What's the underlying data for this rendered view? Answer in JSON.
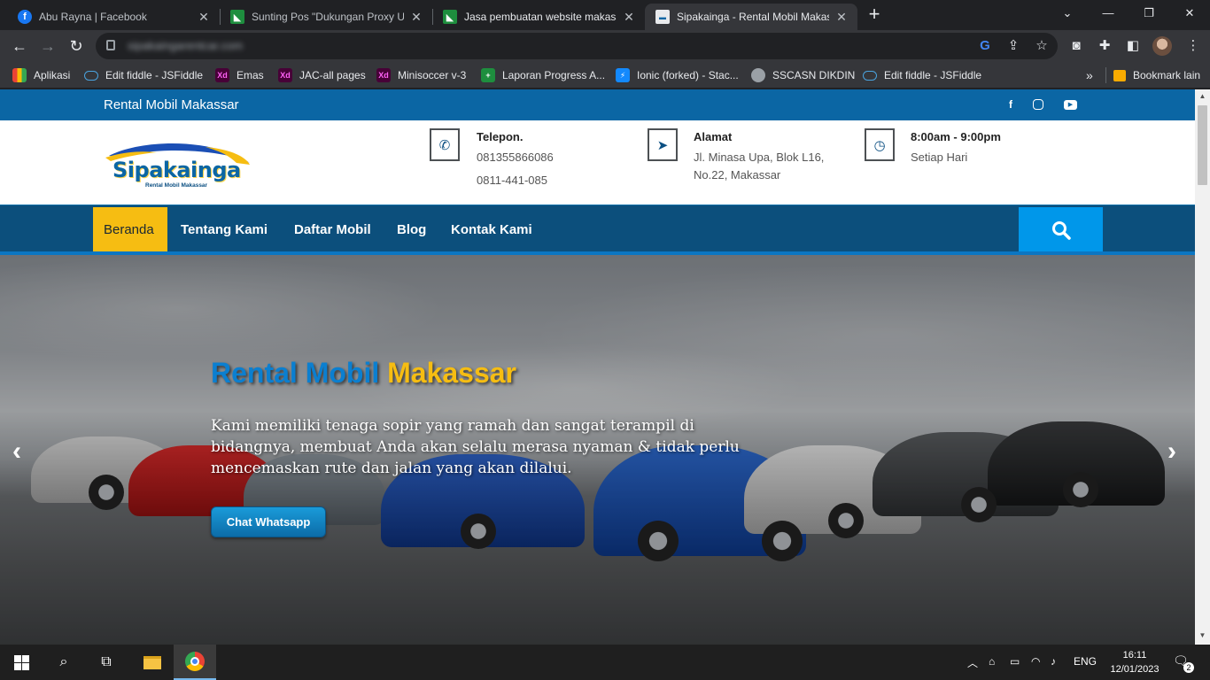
{
  "browser": {
    "tabs": [
      {
        "title": "Abu Rayna | Facebook",
        "icon": "facebook-icon"
      },
      {
        "title": "Sunting Pos \"Dukungan Proxy Ur",
        "icon": "sheet-icon"
      },
      {
        "title": "Jasa pembuatan website makassa",
        "icon": "sheet-icon"
      },
      {
        "title": "Sipakainga - Rental Mobil Makass",
        "icon": "site-icon"
      }
    ],
    "url": "sipakaingarentcar.com",
    "bookmarks": [
      {
        "label": "Aplikasi",
        "icon": "apps-grid-icon"
      },
      {
        "label": "Edit fiddle - JSFiddle",
        "icon": "cloud-icon"
      },
      {
        "label": "Emas",
        "icon": "xd-icon",
        "badge": "Xd"
      },
      {
        "label": "JAC-all pages",
        "icon": "xd-icon",
        "badge": "Xd"
      },
      {
        "label": "Minisoccer v-3",
        "icon": "xd-icon",
        "badge": "Xd"
      },
      {
        "label": "Laporan Progress A...",
        "icon": "sheet-plus-icon"
      },
      {
        "label": "Ionic (forked) - Stac...",
        "icon": "stackblitz-icon"
      },
      {
        "label": "SSCASN DIKDIN",
        "icon": "globe-icon"
      },
      {
        "label": "Edit fiddle - JSFiddle",
        "icon": "cloud-icon"
      }
    ],
    "other_bookmarks": "Bookmark lain"
  },
  "site": {
    "topbar_title": "Rental Mobil Makassar",
    "logo_text": "Sipakainga",
    "logo_sub": "Rental Mobil Makassar",
    "contact": {
      "phone_title": "Telepon.",
      "phone_1": "081355866086",
      "phone_2": "0811-441-085",
      "address_title": "Alamat",
      "address_1": "Jl. Minasa Upa, Blok L16,",
      "address_2": "No.22, Makassar",
      "hours_title": "8:00am - 9:00pm",
      "hours_sub": "Setiap Hari"
    },
    "nav": [
      "Beranda",
      "Tentang Kami",
      "Daftar Mobil",
      "Blog",
      "Kontak Kami"
    ],
    "hero": {
      "title_part1": "Rental Mobil",
      "title_part2": "Makassar",
      "description": "Kami memiliki tenaga sopir yang ramah dan sangat terampil di bidangnya, membuat Anda akan selalu merasa nyaman & tidak perlu mencemaskan rute dan jalan yang akan dilalui.",
      "button": "Chat Whatsapp"
    }
  },
  "taskbar": {
    "language": "ENG",
    "time": "16:11",
    "date": "12/01/2023",
    "notifications": "2"
  },
  "colors": {
    "brand_blue": "#0b66a4",
    "nav_blue": "#0c4f7c",
    "accent_yellow": "#f6bd12",
    "search_blue": "#0097ea"
  }
}
